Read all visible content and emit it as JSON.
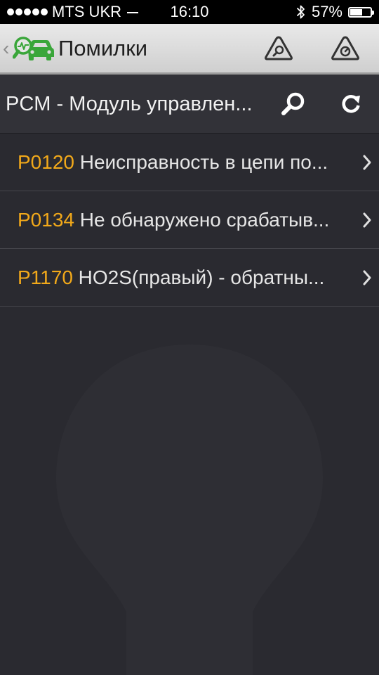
{
  "status_bar": {
    "carrier": "MTS UKR",
    "time": "16:10",
    "battery": "57%",
    "battery_level": 0.57,
    "icons": [
      "signal-dots-icon",
      "network-dash-icon",
      "bluetooth-icon",
      "battery-icon"
    ]
  },
  "header": {
    "title": "Помилки",
    "logo": "car-diagnostics-logo-icon",
    "back_icon": "chevron-left-icon",
    "actions": [
      {
        "icon": "triangle-search-icon"
      },
      {
        "icon": "triangle-gauge-icon"
      }
    ]
  },
  "module": {
    "title": "PCM - Модуль управлен...",
    "actions": [
      {
        "icon": "search-icon"
      },
      {
        "icon": "refresh-icon"
      }
    ]
  },
  "errors": [
    {
      "code": "P0120",
      "description": "Неисправность в цепи по..."
    },
    {
      "code": "P0134",
      "description": "Не обнаружено срабатыв..."
    },
    {
      "code": "P1170",
      "description": "HO2S(правый) - обратны..."
    }
  ],
  "colors": {
    "code": "#f2a91a",
    "background": "#2a2a30",
    "header_bar": "#323238",
    "title_bar": "#dcdcdc",
    "logo_green": "#3aa63a"
  }
}
